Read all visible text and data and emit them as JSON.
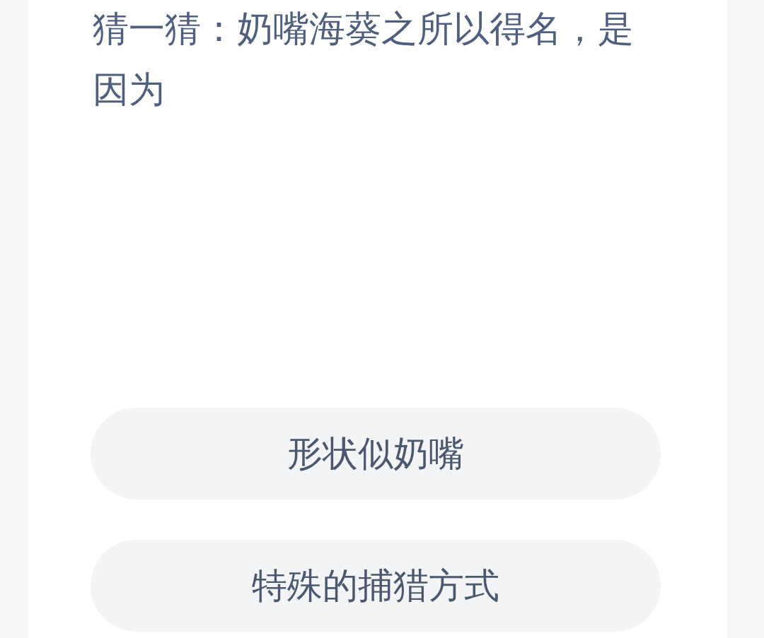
{
  "question": "猜一猜：奶嘴海葵之所以得名，是因为",
  "options": [
    {
      "label": "形状似奶嘴"
    },
    {
      "label": "特殊的捕猎方式"
    }
  ]
}
